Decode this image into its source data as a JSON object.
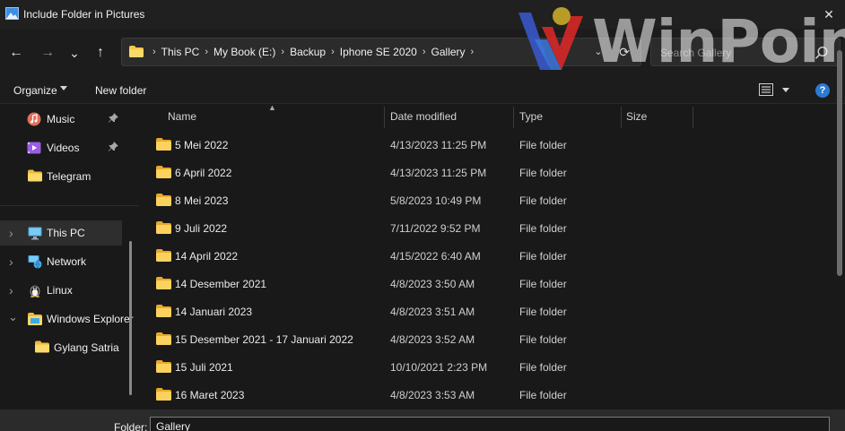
{
  "window": {
    "title": "Include Folder in Pictures",
    "close_glyph": "✕"
  },
  "nav": {
    "back_glyph": "←",
    "forward_glyph": "→",
    "recent_glyph": "⌄",
    "up_glyph": "↑",
    "breadcrumbs": [
      "This PC",
      "My Book (E:)",
      "Backup",
      "Iphone SE 2020",
      "Gallery"
    ],
    "separator_glyph": "›",
    "dropdown_glyph": "⌄",
    "refresh_glyph": "⟳",
    "search_placeholder": "Search Gallery"
  },
  "commands": {
    "organize": "Organize",
    "new_folder": "New folder"
  },
  "sidebar": {
    "items": [
      {
        "label": "Music",
        "icon": "music-icon",
        "pinned": true
      },
      {
        "label": "Videos",
        "icon": "videos-icon",
        "pinned": true
      },
      {
        "label": "Telegram",
        "icon": "folder-icon",
        "pinned": false
      },
      {
        "label": "This PC",
        "icon": "this-pc-icon",
        "selected": true
      },
      {
        "label": "Network",
        "icon": "network-icon"
      },
      {
        "label": "Linux",
        "icon": "linux-icon"
      },
      {
        "label": "Windows Explorer",
        "icon": "folder-icon",
        "expanded": true
      },
      {
        "label": "Gylang Satria",
        "icon": "folder-icon"
      }
    ],
    "pin_glyph": "📌",
    "collapsed_glyph": "›",
    "expanded_glyph": "⌄"
  },
  "columns": {
    "name": "Name",
    "date_modified": "Date modified",
    "type": "Type",
    "size": "Size"
  },
  "files": [
    {
      "name": "5 Mei 2022",
      "date": "4/13/2023 11:25 PM",
      "type": "File folder"
    },
    {
      "name": "6 April 2022",
      "date": "4/13/2023 11:25 PM",
      "type": "File folder"
    },
    {
      "name": "8 Mei 2023",
      "date": "5/8/2023 10:49 PM",
      "type": "File folder"
    },
    {
      "name": "9 Juli 2022",
      "date": "7/11/2022 9:52 PM",
      "type": "File folder"
    },
    {
      "name": "14 April 2022",
      "date": "4/15/2022 6:40 AM",
      "type": "File folder"
    },
    {
      "name": "14 Desember 2021",
      "date": "4/8/2023 3:50 AM",
      "type": "File folder"
    },
    {
      "name": "14 Januari 2023",
      "date": "4/8/2023 3:51 AM",
      "type": "File folder"
    },
    {
      "name": "15 Desember 2021 - 17 Januari 2022",
      "date": "4/8/2023 3:52 AM",
      "type": "File folder"
    },
    {
      "name": "15 Juli 2021",
      "date": "10/10/2021 2:23 PM",
      "type": "File folder"
    },
    {
      "name": "16 Maret 2023",
      "date": "4/8/2023 3:53 AM",
      "type": "File folder"
    }
  ],
  "bottom": {
    "folder_label": "Folder:",
    "folder_value": "Gallery"
  },
  "watermark": {
    "text": "WinPoin"
  },
  "colors": {
    "folder_yellow": "#f8c84a",
    "accent_blue": "#2a7ad4",
    "background": "#191919"
  }
}
